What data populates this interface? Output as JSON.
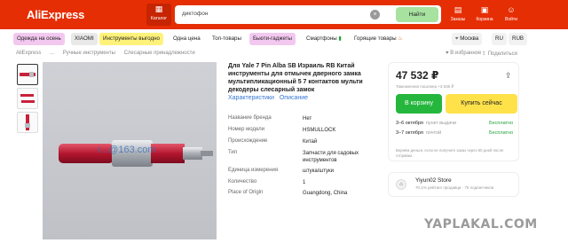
{
  "header": {
    "logo": "AliExpress",
    "catalog_label": "Каталог",
    "search_value": "диктофон",
    "search_button": "Найти",
    "orders_label": "Заказы",
    "cart_label": "Корзина",
    "account_label": "Войти"
  },
  "categories": [
    {
      "label": "Одежда на осень",
      "color": "#f3c8f0"
    },
    {
      "label": "XIAOMI",
      "color": "#e9e9e9"
    },
    {
      "label": "Инструменты выгодно",
      "color": "#fff27a"
    },
    {
      "label": "Одна цена",
      "color": "#ffffff"
    },
    {
      "label": "Топ-товары",
      "color": "#ffffff"
    },
    {
      "label": "Бьюти-гаджеты",
      "color": "#f3c8f0"
    },
    {
      "label": "Смартфоны",
      "color": "#ffffff"
    },
    {
      "label": "Горящие товары",
      "color": "#ffffff"
    }
  ],
  "location": {
    "city": "Москва",
    "language": "RU",
    "currency": "RUB"
  },
  "breadcrumb": [
    "AliExpress",
    "...",
    "Ручные инструменты",
    "Слесарные принадлежности"
  ],
  "actions": {
    "favorites": "В избранное",
    "share": "Поделиться"
  },
  "watermark_email": "r...@163.com",
  "product": {
    "title": "Для Yale 7 Pin Alba SB Израиль RB Китай инструменты для отмычек дверного замка мультипликационный 5 7 контактов мульти декодеры слесарный замок",
    "tabs": [
      "Характеристики",
      "Описание"
    ],
    "specs": [
      {
        "name": "Название бренда",
        "value": "Нет"
      },
      {
        "name": "Номер модели",
        "value": "HSMULLOCK"
      },
      {
        "name": "Происхождение",
        "value": "Китай"
      },
      {
        "name": "Тип",
        "value": "Запчасти для садовых инструментов"
      },
      {
        "name": "Единица измерения",
        "value": "штука/штуки"
      },
      {
        "name": "Количество",
        "value": "1"
      },
      {
        "name": "Place of Origin",
        "value": "Guangdong, China"
      }
    ]
  },
  "purchase": {
    "price": "47 532 ₽",
    "duty_note": "Таможенная пошлина +3 636 ₽",
    "cart_button": "В корзину",
    "buy_button": "Купить сейчас",
    "delivery": [
      {
        "date": "3–6 октября",
        "method": "пункт выдачи",
        "cost": "Бесплатно"
      },
      {
        "date": "3–7 октября",
        "method": "почтой",
        "cost": "Бесплатно"
      }
    ],
    "note": "Вернём деньги, если не получите заказ через 60 дней после отправки."
  },
  "store": {
    "name": "Yiyun02 Store",
    "subtitle": "70,1% рейтинг продавца · 75 подписчиков"
  },
  "site_watermark": "YAPLAKAL.COM",
  "colors": {
    "brand_red": "#e62e04",
    "cart_green": "#25b73d",
    "buy_yellow": "#ffe24a",
    "link_blue": "#3877d6"
  }
}
